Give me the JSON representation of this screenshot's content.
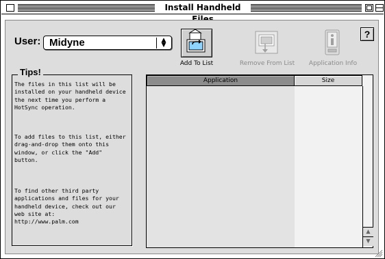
{
  "window": {
    "title": "Install Handheld Files"
  },
  "user": {
    "label": "User:",
    "selected": "Midyne"
  },
  "toolbar": {
    "add_label": "Add To List",
    "remove_label": "Remove From List",
    "info_label": "Application Info",
    "help_label": "?"
  },
  "tips": {
    "title": "Tips!",
    "items": [
      {
        "lines": [
          "The files in this list will be",
          "installed on your handheld device",
          "the next time you perform a",
          "HotSync operation."
        ]
      },
      {
        "lines": [
          "To add files to this list, either",
          "drag-and-drop them onto this",
          "window, or click the \"Add\"",
          "button."
        ]
      },
      {
        "lines": [
          "To find other third party",
          "applications and files for your",
          "handheld device, check out our",
          "web site at:",
          "http://www.palm.com"
        ]
      }
    ]
  },
  "list": {
    "columns": [
      {
        "label": "Application"
      },
      {
        "label": "Size"
      }
    ],
    "rows": []
  },
  "colors": {
    "content_bg": "#dddddd",
    "sorted_column": "#8c8c8c"
  }
}
